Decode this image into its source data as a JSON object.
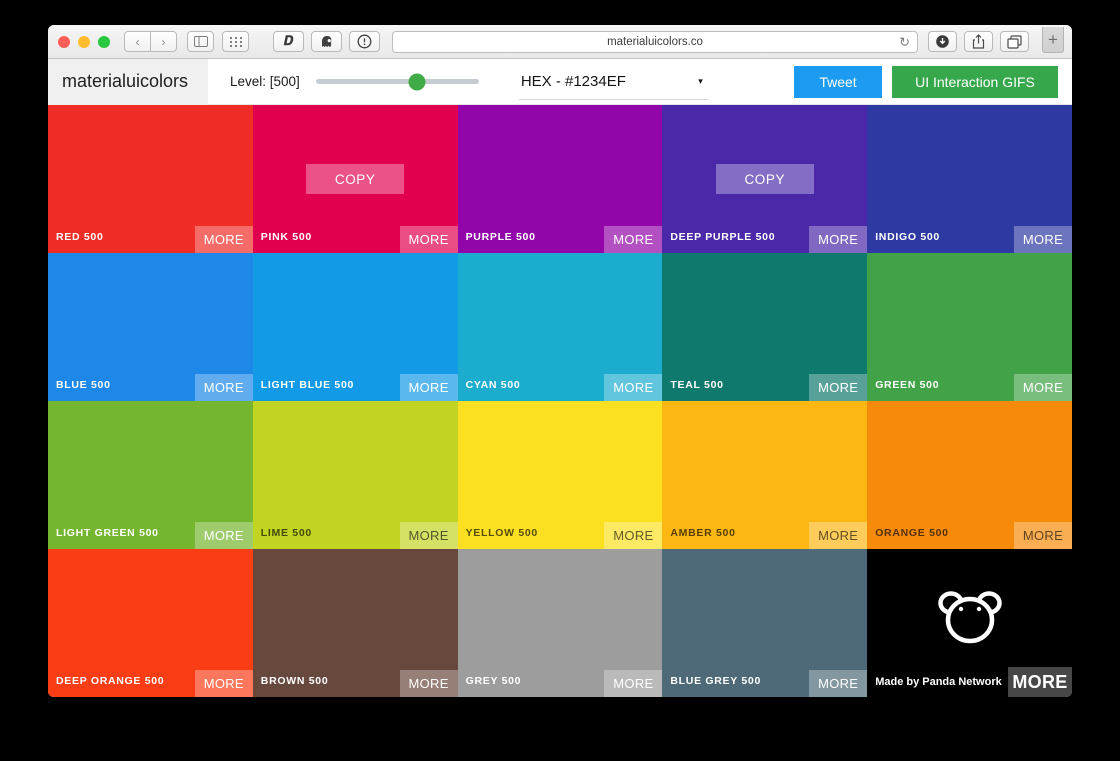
{
  "browser": {
    "url": "materialuicolors.co",
    "traffic_lights": [
      "close",
      "minimize",
      "zoom"
    ],
    "nav": {
      "back": "‹",
      "forward": "›"
    },
    "buttons": {
      "sidebar": "sidebar-icon",
      "tab_overview": "grid-icon",
      "reload": "↻",
      "downloads": "download-icon",
      "share": "share-icon",
      "tabs": "tabs-icon",
      "new_tab": "+"
    },
    "extensions": [
      {
        "name": "dashlane-extension",
        "glyph": "𝑫"
      },
      {
        "name": "ghostery-extension",
        "glyph": "◕"
      },
      {
        "name": "onepassword-extension",
        "glyph": "Ⓘ"
      }
    ]
  },
  "header": {
    "brand": "materialuicolors",
    "level_label": "Level: [500]",
    "slider": {
      "value": 500,
      "thumb_color": "#41ab48",
      "track_color": "#c4ccd2",
      "position_pct": 62
    },
    "format_select": {
      "value": "HEX - #1234EF",
      "arrow": "▾"
    },
    "tweet_label": "Tweet",
    "tweet_color": "#1c9bf0",
    "gifs_label": "UI Interaction GIFS",
    "gifs_color": "#36a74b"
  },
  "grid": {
    "more_label": "MORE",
    "copy_label": "COPY",
    "tiles": [
      {
        "name": "red",
        "label": "RED 500",
        "color": "#ef2c26",
        "dark_text": false,
        "copy_visible": false
      },
      {
        "name": "pink",
        "label": "PINK 500",
        "color": "#e10050",
        "dark_text": false,
        "copy_visible": true
      },
      {
        "name": "purple",
        "label": "PURPLE 500",
        "color": "#9205a8",
        "dark_text": false,
        "copy_visible": false
      },
      {
        "name": "deep-purple",
        "label": "DEEP PURPLE 500",
        "color": "#4b28a8",
        "dark_text": false,
        "copy_visible": true
      },
      {
        "name": "indigo",
        "label": "INDIGO 500",
        "color": "#2f39a2",
        "dark_text": false,
        "copy_visible": false
      },
      {
        "name": "blue",
        "label": "BLUE 500",
        "color": "#1e88e8",
        "dark_text": false,
        "copy_visible": false
      },
      {
        "name": "light-blue",
        "label": "LIGHT BLUE 500",
        "color": "#139ae6",
        "dark_text": false,
        "copy_visible": false
      },
      {
        "name": "cyan",
        "label": "CYAN 500",
        "color": "#1cacce",
        "dark_text": false,
        "copy_visible": false
      },
      {
        "name": "teal",
        "label": "TEAL 500",
        "color": "#10796e",
        "dark_text": false,
        "copy_visible": false
      },
      {
        "name": "green",
        "label": "GREEN 500",
        "color": "#41a248",
        "dark_text": false,
        "copy_visible": false
      },
      {
        "name": "light-green",
        "label": "LIGHT GREEN 500",
        "color": "#74b62f",
        "dark_text": false,
        "copy_visible": false
      },
      {
        "name": "lime",
        "label": "LIME 500",
        "color": "#c2d422",
        "dark_text": true,
        "copy_visible": false
      },
      {
        "name": "yellow",
        "label": "YELLOW 500",
        "color": "#fbe021",
        "dark_text": true,
        "copy_visible": false
      },
      {
        "name": "amber",
        "label": "AMBER 500",
        "color": "#fdb713",
        "dark_text": true,
        "copy_visible": false
      },
      {
        "name": "orange",
        "label": "ORANGE 500",
        "color": "#f68b0b",
        "dark_text": true,
        "copy_visible": false
      },
      {
        "name": "deep-orange",
        "label": "DEEP ORANGE 500",
        "color": "#fb3d15",
        "dark_text": false,
        "copy_visible": false
      },
      {
        "name": "brown",
        "label": "BROWN 500",
        "color": "#67483d",
        "dark_text": false,
        "copy_visible": false
      },
      {
        "name": "grey",
        "label": "GREY 500",
        "color": "#9d9d9d",
        "dark_text": false,
        "copy_visible": false
      },
      {
        "name": "blue-grey",
        "label": "BLUE GREY 500",
        "color": "#4e6a79",
        "dark_text": false,
        "copy_visible": false
      }
    ],
    "panda": {
      "credit": "Made by Panda Network",
      "more_label": "MORE",
      "background": "#000000"
    }
  }
}
